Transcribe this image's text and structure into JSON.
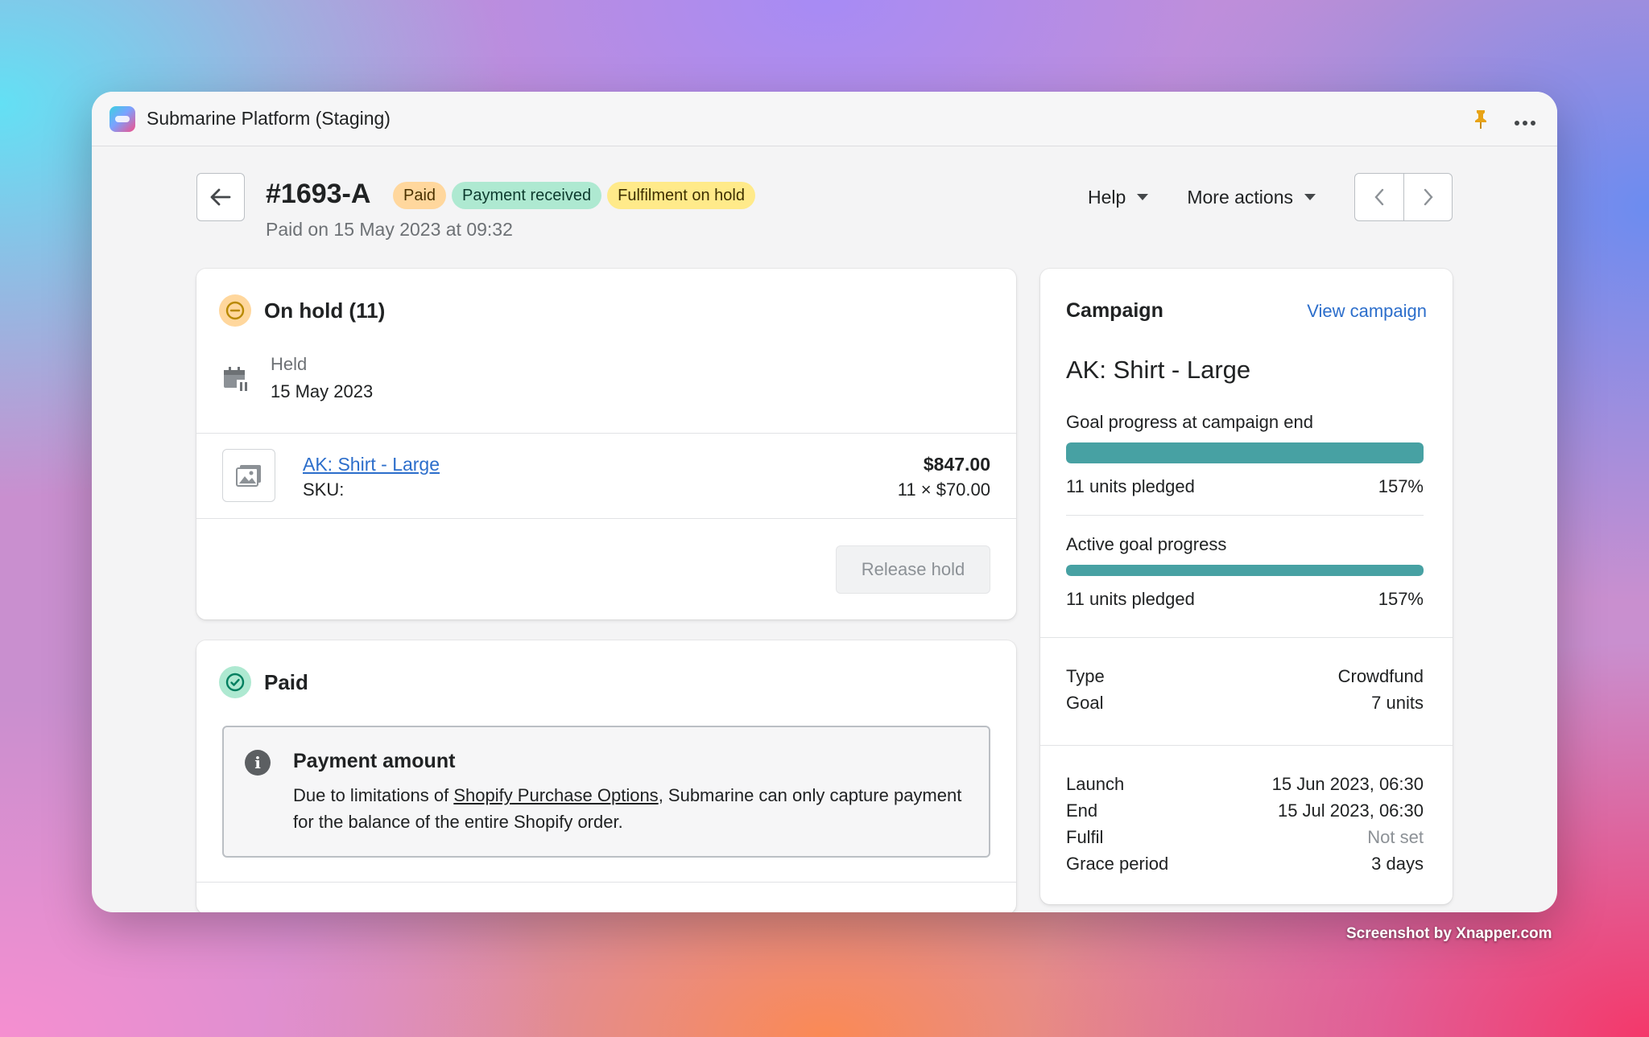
{
  "window": {
    "title": "Submarine Platform (Staging)"
  },
  "header": {
    "order_number": "#1693-A",
    "badges": [
      "Paid",
      "Payment received",
      "Fulfilment on hold"
    ],
    "subtitle": "Paid on 15 May 2023 at 09:32",
    "help_label": "Help",
    "more_actions_label": "More actions"
  },
  "hold_card": {
    "title": "On hold (11)",
    "held_label": "Held",
    "held_date": "15 May 2023",
    "item": {
      "name": "AK: Shirt - Large",
      "sku_label": "SKU:",
      "total": "$847.00",
      "qty_price": "11 × $70.00"
    },
    "release_label": "Release hold"
  },
  "paid_card": {
    "title": "Paid",
    "banner": {
      "title": "Payment amount",
      "text_before": "Due to limitations of ",
      "link_text": "Shopify Purchase Options",
      "text_after": ", Submarine can only capture payment for the balance of the entire Shopify order."
    }
  },
  "campaign": {
    "title": "Campaign",
    "view_link": "View campaign",
    "name": "AK: Shirt - Large",
    "goal_end": {
      "label": "Goal progress at campaign end",
      "units": "11 units pledged",
      "percent": "157%",
      "fill": 1.0
    },
    "goal_active": {
      "label": "Active goal progress",
      "units": "11 units pledged",
      "percent": "157%",
      "fill": 1.0
    },
    "details": [
      {
        "key": "Type",
        "value": "Crowdfund"
      },
      {
        "key": "Goal",
        "value": "7 units"
      }
    ],
    "schedule": [
      {
        "key": "Launch",
        "value": "15 Jun 2023, 06:30",
        "muted": false
      },
      {
        "key": "End",
        "value": "15 Jul 2023, 06:30",
        "muted": false
      },
      {
        "key": "Fulfil",
        "value": "Not set",
        "muted": true
      },
      {
        "key": "Grace period",
        "value": "3 days",
        "muted": false
      }
    ]
  },
  "colors": {
    "accent_link": "#2c6ecb",
    "progress": "#47a1a3",
    "paid_badge": "#ffd79d",
    "received_badge": "#aee9d1",
    "hold_badge": "#ffea8a"
  },
  "icons": [
    "app-logo-icon",
    "pin-icon",
    "more-dots-icon",
    "arrow-left-icon",
    "chevron-left-icon",
    "chevron-right-icon",
    "minus-circle-icon",
    "calendar-hold-icon",
    "image-placeholder-icon",
    "check-circle-icon",
    "info-icon"
  ],
  "watermark": "Screenshot by Xnapper.com"
}
